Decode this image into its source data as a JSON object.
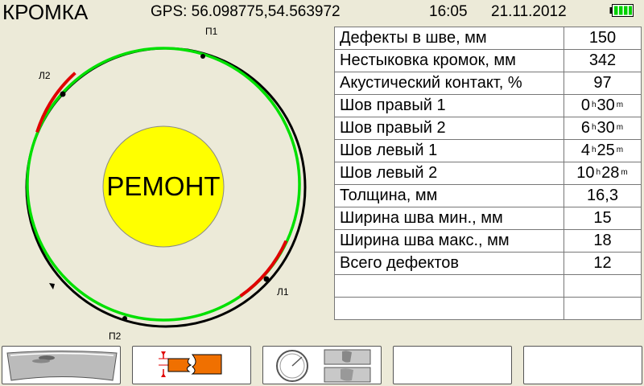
{
  "header": {
    "mode_title": "КРОМКА",
    "gps": "GPS: 56.098775,54.563972",
    "time": "16:05",
    "date": "21.11.2012",
    "battery_icon": "battery-full-icon"
  },
  "diagram": {
    "status": "РЕМОНТ",
    "status_color": "#ffff00",
    "labels": {
      "p1": "П1",
      "p2": "П2",
      "l1": "Л1",
      "l2": "Л2"
    },
    "colors": {
      "ok": "#00e000",
      "defect": "#e00000",
      "pipe": "#000000"
    }
  },
  "table": {
    "rows": [
      {
        "name": "Дефекты в шве, мм",
        "value": "150"
      },
      {
        "name": "Нестыковка кромок, мм",
        "value": "342"
      },
      {
        "name": "Акустический контакт, %",
        "value": "97"
      },
      {
        "name": "Шов правый  1",
        "h": "0",
        "m": "30"
      },
      {
        "name": "Шов правый  2",
        "h": "6",
        "m": "30"
      },
      {
        "name": "Шов левый  1",
        "h": "4",
        "m": "25"
      },
      {
        "name": "Шов левый  2",
        "h": "10",
        "m": "28"
      },
      {
        "name": "Толщина, мм",
        "value": "16,3"
      },
      {
        "name": "Ширина шва мин., мм",
        "value": "15"
      },
      {
        "name": "Ширина шва макс., мм",
        "value": "18"
      },
      {
        "name": "Всего дефектов",
        "value": "12"
      },
      {
        "name": "",
        "value": ""
      },
      {
        "name": "",
        "value": ""
      }
    ],
    "units": {
      "h": "h",
      "m": "m"
    }
  },
  "buttons": [
    {
      "icon": "weld-bead-icon"
    },
    {
      "icon": "edge-mismatch-icon"
    },
    {
      "icon": "circumference-scan-icon"
    },
    {
      "icon": "empty"
    },
    {
      "icon": "empty"
    }
  ]
}
